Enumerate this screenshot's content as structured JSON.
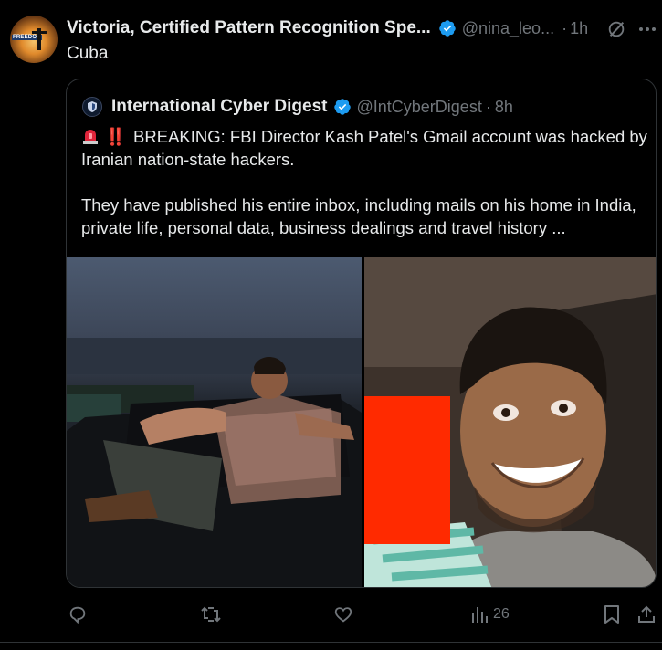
{
  "post": {
    "author_name": "Victoria, Certified Pattern Recognition Spe...",
    "author_handle": "@nina_leo...",
    "separator": "·",
    "time": "1h",
    "text": "Cuba",
    "avatar_label": "FREEDOM"
  },
  "quoted": {
    "author_name": "International Cyber Digest",
    "author_handle": "@IntCyberDigest",
    "separator": "·",
    "time": "8h",
    "paragraph1_prefix": "‼️",
    "paragraph1": "BREAKING: FBI Director Kash Patel's Gmail account was hacked by Iranian nation-state hackers.",
    "paragraph2": "They have published his entire inbox, including mails on his home in India, private life, personal data, business dealings and travel history ..."
  },
  "actions": {
    "view_count": "26"
  },
  "colors": {
    "verified": "#1d9bf0",
    "muted": "#71767b",
    "text": "#e7e9ea",
    "border": "#2f3336",
    "redaction": "#ff2a00"
  },
  "icons": [
    "grok-icon",
    "more-icon",
    "verified-icon",
    "reply-icon",
    "repost-icon",
    "like-icon",
    "views-icon",
    "bookmark-icon",
    "share-icon",
    "siren-icon"
  ]
}
